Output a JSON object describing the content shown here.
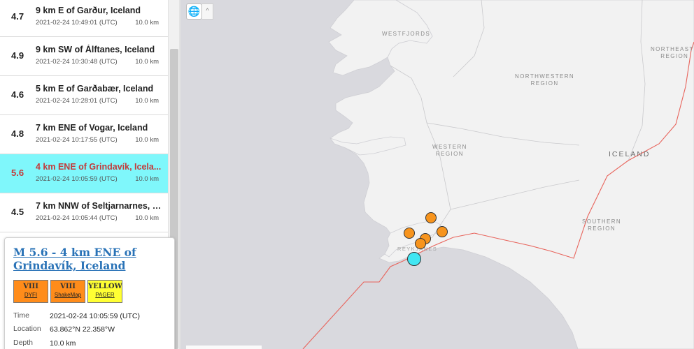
{
  "events": [
    {
      "mag": "4.7",
      "place": "9 km E of Garður, Iceland",
      "time": "2021-02-24 10:49:01 (UTC)",
      "depth": "10.0 km"
    },
    {
      "mag": "4.9",
      "place": "9 km SW of Álftanes, Iceland",
      "time": "2021-02-24 10:30:48 (UTC)",
      "depth": "10.0 km"
    },
    {
      "mag": "4.6",
      "place": "5 km E of Garðabær, Iceland",
      "time": "2021-02-24 10:28:01 (UTC)",
      "depth": "10.0 km"
    },
    {
      "mag": "4.8",
      "place": "7 km ENE of Vogar, Iceland",
      "time": "2021-02-24 10:17:55 (UTC)",
      "depth": "10.0 km"
    },
    {
      "mag": "5.6",
      "place": "4 km ENE of Grindavík, Icela...",
      "time": "2021-02-24 10:05:59 (UTC)",
      "depth": "10.0 km",
      "selected": true
    },
    {
      "mag": "4.5",
      "place": "7 km NNW of Seltjarnarnes, I...",
      "time": "2021-02-24 10:05:44 (UTC)",
      "depth": "10.0 km"
    }
  ],
  "detail": {
    "title": "M 5.6 - 4 km ENE of Grindavík, Iceland",
    "badges": [
      {
        "level": "VIII",
        "label": "DYFI",
        "color": "#ff8c1a"
      },
      {
        "level": "VIII",
        "label": "ShakeMap",
        "color": "#ff8c1a"
      },
      {
        "level": "YELLOW",
        "label": "PAGER",
        "color": "#ffff33"
      }
    ],
    "fields": [
      {
        "key": "Time",
        "value": "2021-02-24 10:05:59 (UTC)"
      },
      {
        "key": "Location",
        "value": "63.862°N 22.358°W"
      },
      {
        "key": "Depth",
        "value": "10.0 km"
      }
    ]
  },
  "map": {
    "labels": {
      "westfjords": "WESTFJORDS",
      "northwestern": "NORTHWESTERN\nREGION",
      "northeastern": "NORTHEASTE\nREGION",
      "western": "WESTERN\nREGION",
      "iceland": "ICELAND",
      "southern": "SOUTHERN\nREGION",
      "reykjanes": "REYKJANES"
    },
    "colors": {
      "water": "#d9d9de",
      "land": "#f2f2f2",
      "plate_boundary": "#e8645c",
      "event_marker": "#f7941d",
      "selected_marker": "#41e6f2"
    },
    "toolbar": {
      "globe_icon": "globe-icon",
      "collapse_glyph": "^"
    }
  }
}
